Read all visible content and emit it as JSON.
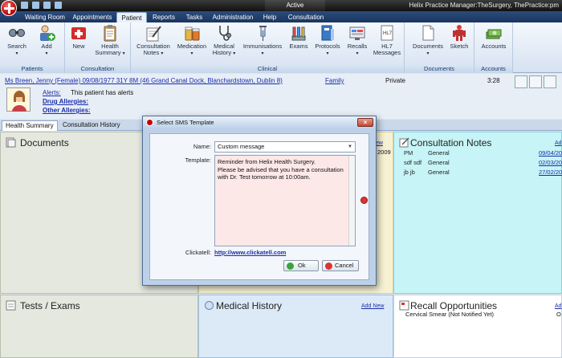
{
  "window": {
    "status": "Active",
    "title": "Helix Practice Manager:TheSurgery, ThePractice:pm"
  },
  "menu_tabs": [
    "Waiting Room",
    "Appointments",
    "Patient",
    "Reports",
    "Tasks",
    "Administration",
    "Help",
    "Consultation"
  ],
  "selected_tab": "Patient",
  "ribbon": {
    "groups": [
      "Patients",
      "Consultation",
      "Clinical",
      "Documents",
      "Accounts"
    ],
    "buttons": {
      "search": "Search",
      "add": "Add",
      "new": "New",
      "health_summary": "Health Summary",
      "consultation_notes": "Consultation Notes",
      "medication": "Medication",
      "medical_history": "Medical History",
      "immunisations": "Immunisations",
      "exams": "Exams",
      "protocols": "Protocols",
      "recalls": "Recalls",
      "hl7_messages": "HL7 Messages",
      "documents": "Documents",
      "sketch": "Sketch",
      "accounts": "Accounts"
    }
  },
  "patient": {
    "summary": "Ms Breen, Jenny (Female) 09/08/1977 31Y 8M (46 Grand Canal Dock, Blanchardstown, Dublin 8)",
    "family_link": "Family",
    "privacy": "Private",
    "time": "3:28",
    "alerts_label": "Alerts:",
    "alerts_text": "This patient has alerts",
    "drug_allergies_label": "Drug Allergies:",
    "other_allergies_label": "Other Allergies:"
  },
  "content_tabs": [
    "Health Summary",
    "Consultation History"
  ],
  "panels": {
    "documents": {
      "title": "Documents"
    },
    "center_fragment": {
      "date_fragment": "2009",
      "link_fragment": "ew"
    },
    "consultation_notes": {
      "title": "Consultation Notes",
      "add_label": "Ad",
      "rows": [
        {
          "author": "PM",
          "category": "General",
          "date": "09/04/200"
        },
        {
          "author": "sdf sdf",
          "category": "General",
          "date": "02/03/200"
        },
        {
          "author": "jb jb",
          "category": "General",
          "date": "27/02/200"
        }
      ]
    },
    "tests_exams": {
      "title": "Tests / Exams"
    },
    "medical_history": {
      "title": "Medical History",
      "add_label": "Add New"
    },
    "recall": {
      "title": "Recall Opportunities",
      "add_label": "Ad",
      "item": "Cervical Smear (Not Notified Yet)",
      "item_tail": "O"
    }
  },
  "dialog": {
    "title": "Select SMS Template",
    "name_label": "Name:",
    "name_value": "Custom message",
    "template_label": "Template:",
    "template_text": "Reminder from Helix Health Surgery.\nPlease be advised that you have a consultation\nwith Dr. Test tomorrow at 10:00am.",
    "clickatell_label": "Clickatell:",
    "clickatell_link": "http://www.clickatell.com",
    "ok_label": "Ok",
    "cancel_label": "Cancel"
  },
  "colors": {
    "title_bar": "#111111",
    "tab_strip": "#1a355e",
    "link": "#1b2fa8",
    "notes_panel": "#c7f4f6",
    "template_bg": "#fde8e8"
  }
}
